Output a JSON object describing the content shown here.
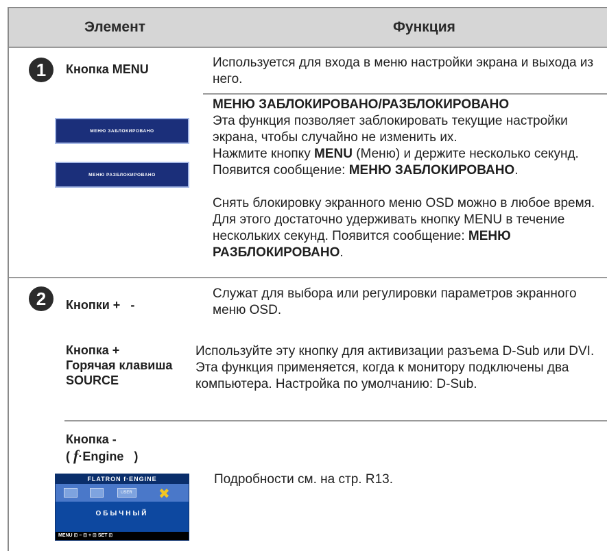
{
  "header": {
    "element": "Элемент",
    "function": "Функция"
  },
  "item1": {
    "num": "1",
    "label": "Кнопка MENU",
    "text": "Используется для входа в меню настройки экрана и выхода из него.",
    "lock_title": "МЕНЮ ЗАБЛОКИРОВАНО/РАЗБЛОКИРОВАНО",
    "lock_p1": "Эта функция позволяет заблокировать текущие настройки экрана, чтобы случайно не изменить их.",
    "lock_p2a": "Нажмите кнопку ",
    "lock_p2b": "MENU",
    "lock_p2c": " (Меню) и держите несколько секунд. Появится сообщение: ",
    "lock_p2d": "МЕНЮ ЗАБЛОКИРОВАНО",
    "lock_p2e": ".",
    "lock_p3a": "Снять блокировку экранного меню OSD можно в любое время. Для этого достаточно удерживать кнопку MENU в течение нескольких секунд. Появится сообщение: ",
    "lock_p3b": "МЕНЮ РАЗБЛОКИРОВАНО",
    "lock_p3c": ".",
    "osd_locked": "МЕНЮ ЗАБЛОКИРОВАНО",
    "osd_unlocked": "МЕНЮ РАЗБЛОКИРОВАНО"
  },
  "item2": {
    "num": "2",
    "label": "Кнопки +   -",
    "text": "Служат для выбора или регулировки параметров экранного меню OSD.",
    "plus_label1": "Кнопка +",
    "plus_label2": "Горячая клавиша",
    "plus_label3": "SOURCE",
    "plus_text": "Используйте эту кнопку для активизации разъема D-Sub или DVI. Эта функция применяется, когда к монитору подключены два компьютера. Настройка по умолчанию: D-Sub.",
    "minus_label1": "Кнопка -",
    "minus_label2a": "( ",
    "minus_label2b": "f",
    "minus_label2c": "·Engine   )",
    "minus_text": "Подробности см. на стр. R13.",
    "osd_title": "FLATRON  f·ENGINE",
    "osd_mode": "ОБЫЧНЫЙ",
    "osd_icon_label": "USER",
    "osd_bar": "MENU ⊡  –  ⊟   +  ⊡      SET ⊡"
  },
  "colors": {
    "header_bg": "#d6d6d6",
    "osd_blue": "#0d48a0",
    "lock_blue": "#1b2f7a"
  }
}
